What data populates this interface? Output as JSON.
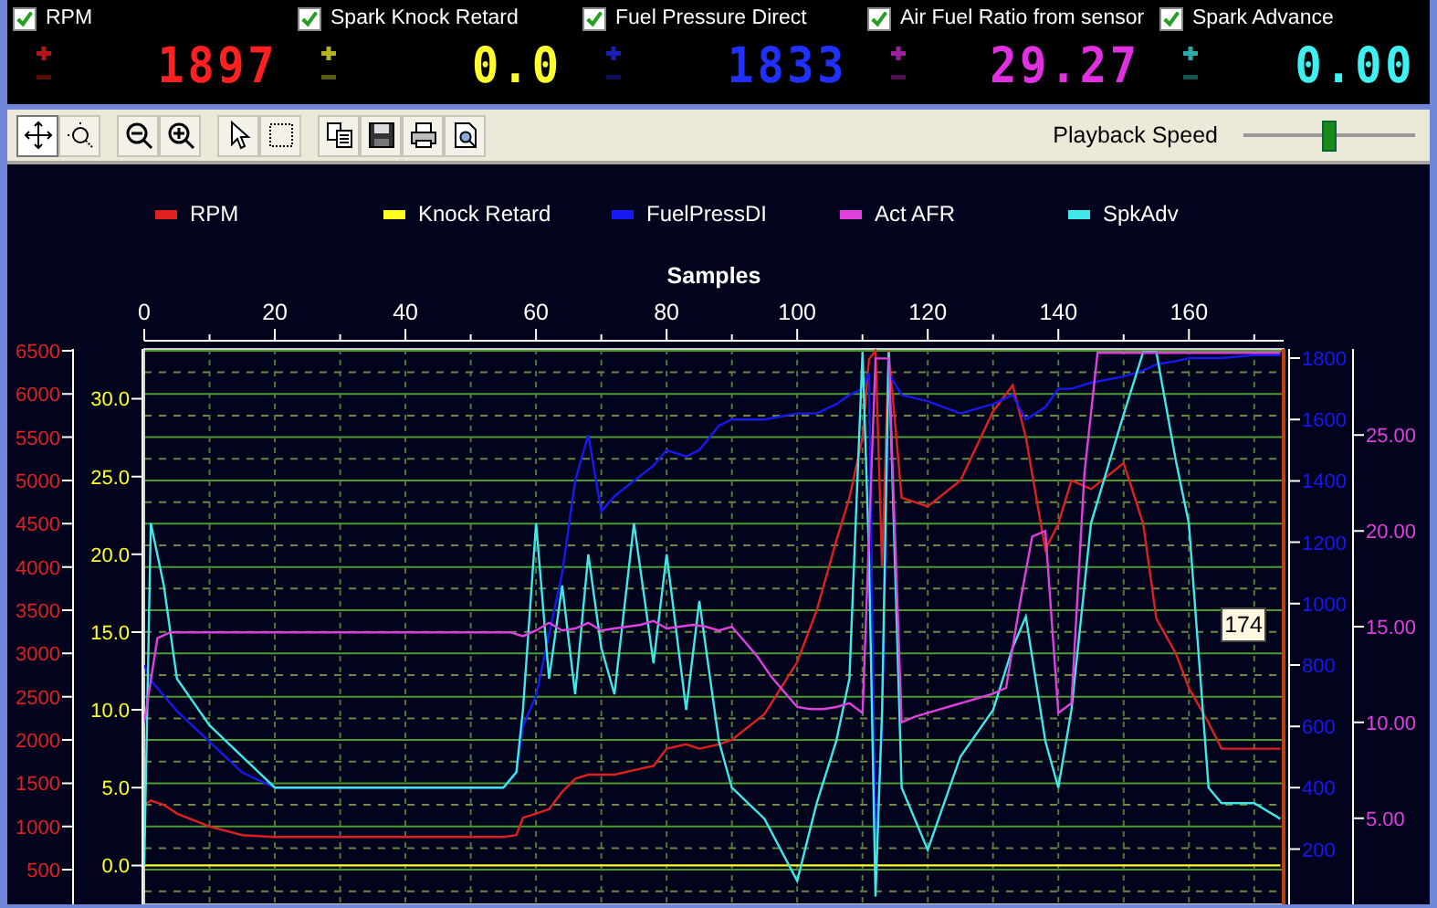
{
  "channels": [
    {
      "label": "RPM",
      "checked": true,
      "reading": "1897",
      "color": "#ff2020"
    },
    {
      "label": "Spark Knock Retard",
      "checked": true,
      "reading": "0.0",
      "color": "#ffff30"
    },
    {
      "label": "Fuel Pressure Direct",
      "checked": true,
      "reading": "1833",
      "color": "#2030ff"
    },
    {
      "label": "Air Fuel Ratio from sensor",
      "checked": true,
      "reading": "29.27",
      "color": "#e030e0"
    },
    {
      "label": "Spark Advance",
      "checked": true,
      "reading": "0.00",
      "color": "#40f0f0"
    }
  ],
  "toolbar": {
    "buttons": [
      {
        "kind": "pan",
        "selected": true
      },
      {
        "kind": "zoom-area",
        "selected": false
      },
      {
        "kind": "zoom-out",
        "selected": false
      },
      {
        "kind": "zoom-in",
        "selected": false
      },
      {
        "kind": "pointer",
        "selected": false
      },
      {
        "kind": "select",
        "selected": false
      },
      {
        "kind": "copy",
        "selected": false
      },
      {
        "kind": "save",
        "selected": false
      },
      {
        "kind": "print",
        "selected": false
      },
      {
        "kind": "preview",
        "selected": false
      }
    ],
    "speed_label": "Playback Speed",
    "speed_slider": {
      "level": 0.5
    }
  },
  "chart": {
    "chart_data": {
      "type": "line",
      "xlabel": "Samples",
      "xlim": [
        0,
        174.5
      ],
      "xticks": [
        0,
        20,
        40,
        60,
        80,
        100,
        120,
        140,
        160
      ],
      "x": [
        0,
        1,
        3,
        5,
        10,
        15,
        20,
        30,
        40,
        50,
        55,
        57,
        58,
        60,
        62,
        64,
        66,
        68,
        70,
        72,
        75,
        78,
        80,
        83,
        85,
        88,
        90,
        95,
        100,
        103,
        106,
        108,
        110,
        111,
        112,
        113,
        114,
        116,
        120,
        125,
        130,
        133,
        135,
        138,
        140,
        142,
        145,
        150,
        153,
        155,
        158,
        160,
        163,
        165,
        170,
        174
      ],
      "ylim": [
        -2.5,
        33.2
      ],
      "yticks": [
        {
          "value": 0,
          "label": "0.0"
        },
        {
          "value": 5,
          "label": "5.0"
        },
        {
          "value": 10,
          "label": "10.0"
        },
        {
          "value": 15,
          "label": "15.0"
        },
        {
          "value": 20,
          "label": "20.0"
        },
        {
          "value": 25,
          "label": "25.0"
        },
        {
          "value": 30,
          "label": "30.0"
        }
      ],
      "y2lim": [
        100,
        6520
      ],
      "y2ticks": [
        500,
        1000,
        1500,
        2000,
        2500,
        3000,
        3500,
        4000,
        4500,
        5000,
        5500,
        6000,
        6500
      ],
      "y3lim": [
        20,
        1830
      ],
      "y3ticks": [
        200,
        400,
        600,
        800,
        1000,
        1200,
        1400,
        1600,
        1800
      ],
      "series": [
        {
          "name": "RPM",
          "color": "#e02020",
          "axis": "y2",
          "values": [
            1250,
            1300,
            1250,
            1150,
            1000,
            900,
            880,
            880,
            880,
            880,
            880,
            900,
            1100,
            1150,
            1200,
            1400,
            1550,
            1600,
            1600,
            1600,
            1650,
            1700,
            1900,
            1950,
            1900,
            1950,
            2000,
            2300,
            2900,
            3500,
            4300,
            4800,
            5500,
            6400,
            6500,
            4000,
            6500,
            4800,
            4700,
            5000,
            5800,
            6100,
            5500,
            4200,
            4500,
            5000,
            4900,
            5200,
            4500,
            3400,
            3000,
            2600,
            2200,
            1900,
            1900,
            1900
          ]
        },
        {
          "name": "Knock Retard",
          "color": "#ffff20",
          "values": [
            0,
            0,
            0,
            0,
            0,
            0,
            0,
            0,
            0,
            0,
            0,
            0,
            0,
            0,
            0,
            0,
            0,
            0,
            0,
            0,
            0,
            0,
            0,
            0,
            0,
            0,
            0,
            0,
            0,
            0,
            0,
            0,
            0,
            0,
            0,
            0,
            0,
            0,
            0,
            0,
            0,
            0,
            0,
            0,
            0,
            0,
            0,
            0,
            0,
            0,
            0,
            0,
            0,
            0,
            0,
            0
          ]
        },
        {
          "name": "FuelPressDI",
          "color": "#1818f0",
          "axis": "y3",
          "values": [
            800,
            750,
            700,
            650,
            550,
            450,
            400,
            400,
            400,
            400,
            400,
            450,
            600,
            700,
            900,
            1100,
            1400,
            1550,
            1300,
            1350,
            1400,
            1450,
            1500,
            1480,
            1500,
            1580,
            1600,
            1600,
            1620,
            1620,
            1650,
            1680,
            1700,
            1750,
            200,
            600,
            1750,
            1680,
            1660,
            1620,
            1650,
            1680,
            1600,
            1640,
            1700,
            1700,
            1720,
            1740,
            1760,
            1780,
            1790,
            1800,
            1800,
            1800,
            1810,
            1810
          ]
        },
        {
          "name": "SpkAdv",
          "color": "#40e8e8",
          "values": [
            0,
            22,
            18,
            12,
            9,
            7,
            5,
            5,
            5,
            5,
            5,
            6,
            10,
            22,
            12,
            18,
            11,
            20,
            14,
            11,
            22,
            13,
            20,
            10,
            17,
            8,
            5,
            3,
            -1,
            4,
            8,
            12,
            33,
            20,
            -2,
            10,
            33,
            5,
            1,
            7,
            10,
            14,
            16,
            8,
            5,
            10,
            22,
            29,
            33,
            33,
            26,
            22,
            5,
            4,
            4,
            3
          ]
        }
      ],
      "annotations": [
        "174"
      ],
      "grid": true,
      "legend": "top"
    }
  },
  "afr_chart": {
    "chart_data": {
      "type": "line",
      "ylim": [
        0.5,
        29.5
      ],
      "yticks": [
        {
          "value": 5,
          "label": "5.00"
        },
        {
          "value": 10,
          "label": "10.00"
        },
        {
          "value": 15,
          "label": "15.00"
        },
        {
          "value": 20,
          "label": "20.00"
        },
        {
          "value": 25,
          "label": "25.00"
        }
      ],
      "series": [
        {
          "name": "Act AFR",
          "color": "#e040e0",
          "values": [
            10,
            14.4,
            14.7,
            14.7,
            14.7,
            14.7,
            14.7,
            14.7,
            14.7,
            14.7,
            14.7,
            14.7,
            14.7,
            14.7,
            14.7,
            14.7,
            14.7,
            14.7,
            14.7,
            14.7,
            14.7,
            14.7,
            14.7,
            14.7,
            14.7,
            14.7,
            14.7,
            14.7,
            14.7,
            14.5,
            14.8,
            15.2,
            14.8,
            14.9,
            15.2,
            14.8,
            14.9,
            15,
            15.1,
            15.3,
            14.9,
            15,
            15.1,
            15,
            14.8,
            15,
            14.2,
            13.4,
            12.4,
            11.6,
            10.8,
            10.7,
            10.7,
            10.8,
            11,
            10.5,
            29,
            29,
            10,
            10.3,
            10.5,
            10.7,
            10.9,
            11.1,
            11.3,
            11.5,
            11.8,
            16,
            19.7,
            20,
            10.5,
            11,
            23,
            29.3,
            29.3,
            29.3,
            29.3,
            29.3,
            29.3,
            29.3,
            29.3,
            29.3,
            29.3,
            29.3,
            29.3,
            29.3,
            29.3,
            29.3
          ]
        }
      ]
    }
  }
}
